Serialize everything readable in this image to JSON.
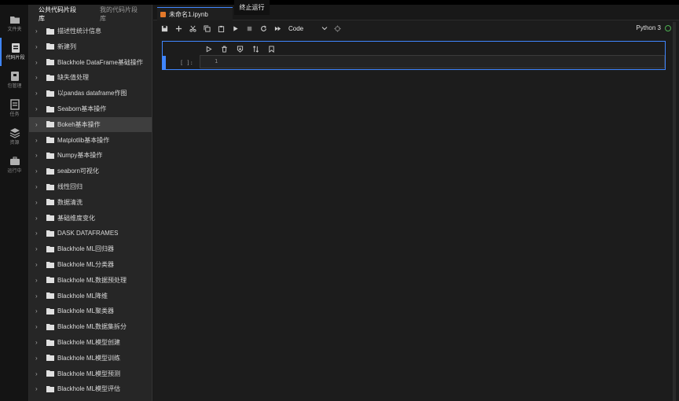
{
  "activity": [
    {
      "label": "文件夹",
      "icon": "folder-icon"
    },
    {
      "label": "代码片段",
      "icon": "snippet-icon"
    },
    {
      "label": "包管理",
      "icon": "package-icon"
    },
    {
      "label": "任务",
      "icon": "tasks-icon"
    },
    {
      "label": "资源",
      "icon": "layers-icon"
    },
    {
      "label": "运行中",
      "icon": "briefcase-icon"
    }
  ],
  "sidebar": {
    "tabs": [
      "公共代码片段库",
      "我的代码片段库"
    ],
    "items": [
      "描述性统计信息",
      "新建列",
      "Blackhole DataFrame基础操作",
      "缺失值处理",
      "以pandas dataframe作图",
      "Seaborn基本操作",
      "Bokeh基本操作",
      "Matplotlib基本操作",
      "Numpy基本操作",
      "seaborn可视化",
      "线性回归",
      "数据清洗",
      "基础维度变化",
      "DASK DATAFRAMES",
      "Blackhole ML回归器",
      "Blackhole ML分类器",
      "Blackhole ML数据预处理",
      "Blackhole ML降维",
      "Blackhole ML聚类器",
      "Blackhole ML数据集拆分",
      "Blackhole ML模型创建",
      "Blackhole ML模型训练",
      "Blackhole ML模型预测",
      "Blackhole ML模型评估"
    ],
    "selected_index": 6
  },
  "notebook": {
    "tab_title": "未命名1.ipynb",
    "tooltip": "终止运行",
    "cell_type": "Code",
    "kernel": "Python 3",
    "prompt": "[ ]:",
    "line_number": "1"
  },
  "colors": {
    "accent": "#3f86ff",
    "kernel_ok": "#4caf50"
  }
}
